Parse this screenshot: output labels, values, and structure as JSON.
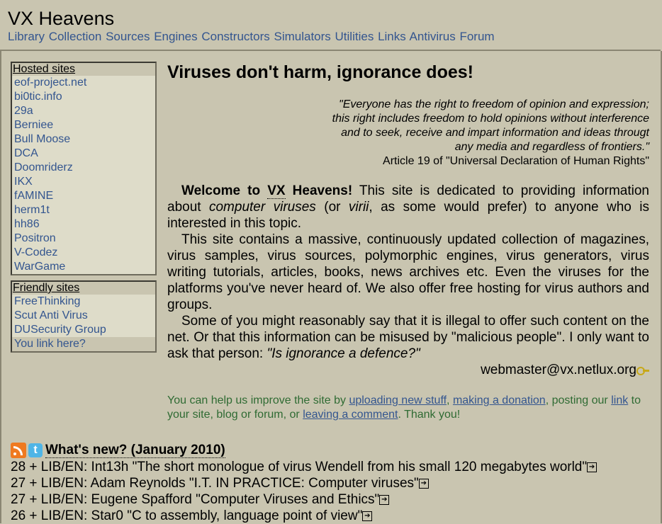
{
  "header": {
    "title": "VX Heavens",
    "nav": [
      "Library",
      "Collection",
      "Sources",
      "Engines",
      "Constructors",
      "Simulators",
      "Utilities",
      "Links",
      "Antivirus",
      "Forum"
    ]
  },
  "hosted": {
    "title": "Hosted sites",
    "items": [
      "eof-project.net",
      "bi0tic.info",
      "29a",
      "Berniee",
      "Bull Moose",
      "DCA",
      "Doomriderz",
      "IKX",
      "fAMINE",
      "herm1t",
      "hh86",
      "Positron",
      "V-Codez",
      "WarGame"
    ]
  },
  "friendly": {
    "title": "Friendly sites",
    "items": [
      "FreeThinking",
      "Scut Anti Virus",
      "DUSecurity Group",
      "You link here?"
    ]
  },
  "main": {
    "slogan": "Viruses don't harm, ignorance does!",
    "quote_lines": [
      "\"Everyone has the right to freedom of opinion and expression;",
      "this right includes freedom to hold opinions without interference",
      "and to seek, receive and impart information and ideas througt",
      "any media and regardless of frontiers.\""
    ],
    "quote_source": "Article 19 of \"Universal Declaration of Human Rights\"",
    "welcome_bold_a": "Welcome to ",
    "welcome_abbr": "VX",
    "welcome_bold_b": " Heavens!",
    "welcome_rest_1": " This site is dedicated to providing information about ",
    "welcome_em_1": "computer viruses",
    "welcome_rest_2": " (or ",
    "welcome_em_2": "virii",
    "welcome_rest_3": ", as some would prefer) to anyone who is interested in this topic.",
    "para2": "This site contains a massive, continuously updated collection of magazines, virus samples, virus sources, polymorphic engines, virus generators, virus writing tutorials, articles, books, news archives etc. Even the viruses for the platforms you've never heard of. We also offer free hosting for virus authors and groups.",
    "para3": "Some of you might reasonably say that it is illegal to offer such content on the net. Or that this information can be misused by \"malicious people\". I only want to ask that person: ",
    "para3_em": "\"Is ignorance a defence?\"",
    "email": "webmaster@vx.netlux.org",
    "help_1": "You can help us improve the site by ",
    "help_link_1": "uploading new stuff",
    "help_2": ", ",
    "help_link_2": "making a donation",
    "help_3": ", posting our ",
    "help_link_3": "link",
    "help_4": " to your site, blog or forum, or ",
    "help_link_4": "leaving a comment",
    "help_5": ". Thank you!"
  },
  "news": {
    "title": "What's new? (January 2010)",
    "rows": [
      "28 + LIB/EN: Int13h \"The short monologue of virus Wendell from his small 120 megabytes world\"",
      "27 + LIB/EN: Adam Reynolds \"I.T. IN PRACTICE: Computer viruses\"",
      "27 + LIB/EN: Eugene Spafford \"Computer Viruses and Ethics\"",
      "26 + LIB/EN: Star0 \"C to assembly, language point of view\""
    ]
  },
  "colors": {
    "background": "#c9c5b0",
    "link": "#33558f",
    "help_text": "#2f6b33",
    "box_bg": "#dedcc9"
  },
  "icons": [
    "rss-icon",
    "twitter-icon",
    "key-icon",
    "arrow-link-icon"
  ]
}
